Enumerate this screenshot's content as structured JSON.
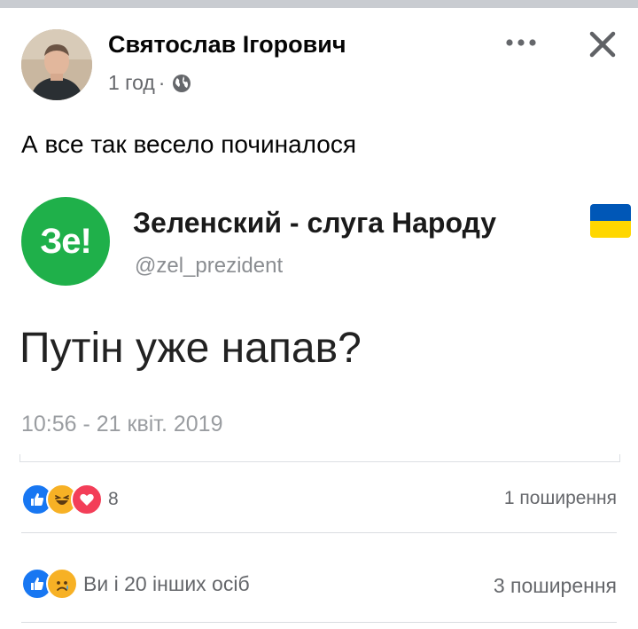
{
  "post": {
    "author": "Святослав Ігорович",
    "time": "1 год",
    "separator": "·",
    "privacy_icon": "globe-icon",
    "caption": "А все так весело починалося"
  },
  "header_actions": {
    "more_label": "•••",
    "close_icon": "close-icon"
  },
  "tweet": {
    "logo_text": "Зе!",
    "logo_color": "#1fb04a",
    "name": "Зеленский - слуга Народу",
    "handle": "@zel_prezident",
    "text": "Путін уже напав?",
    "timestamp": "10:56 - 21 квіт. 2019",
    "flag_colors": [
      "#0057b7",
      "#ffd700"
    ]
  },
  "reactions_shared": {
    "icons": [
      "like-icon",
      "haha-icon",
      "love-icon"
    ],
    "count": "8",
    "shares": "1 поширення"
  },
  "reactions_original": {
    "icons": [
      "like-icon",
      "sad-icon"
    ],
    "summary": "Ви і 20 інших осіб",
    "shares": "3 поширення"
  },
  "colors": {
    "like": "#1877f2",
    "love": "#f33e58",
    "haha": "#f7b125",
    "secondary_text": "#65676b"
  }
}
